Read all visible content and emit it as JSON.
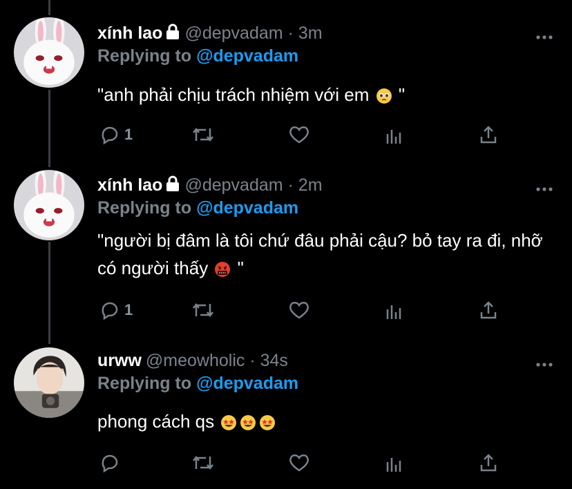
{
  "tweets": [
    {
      "name": "xính lao",
      "handle": "@depvadam · 3m",
      "replying_prefix": "Replying to ",
      "replying_to": "@depvadam",
      "text": "\"anh phải chịu trách nhiệm với em ",
      "text_tail": " \"",
      "emoji": "pleading-face",
      "reply_count": "1",
      "avatar": "white-rabbit-avatar"
    },
    {
      "name": "xính lao",
      "handle": "@depvadam · 2m",
      "replying_prefix": "Replying to ",
      "replying_to": "@depvadam",
      "text": "\"người bị đâm là tôi chứ đâu phải cậu? bỏ tay ra đi, nhỡ có người thấy ",
      "text_tail": " \"",
      "emoji": "face-with-symbols-on-mouth",
      "reply_count": "1",
      "avatar": "white-rabbit-avatar"
    },
    {
      "name": "urww",
      "handle": "@meowholic · 34s",
      "replying_prefix": "Replying to ",
      "replying_to": "@depvadam",
      "text": "phong cách qs ",
      "text_tail": "",
      "emoji": "star-struck x3",
      "reply_count": "",
      "avatar": "person-avatar"
    }
  ],
  "icons": [
    "reply-icon",
    "retweet-icon",
    "like-icon",
    "analytics-icon",
    "share-icon",
    "more-icon",
    "lock-icon"
  ],
  "colors": {
    "background": "#000000",
    "accent": "#1d9bf0",
    "muted": "#7a838b",
    "text": "#ffffff"
  }
}
